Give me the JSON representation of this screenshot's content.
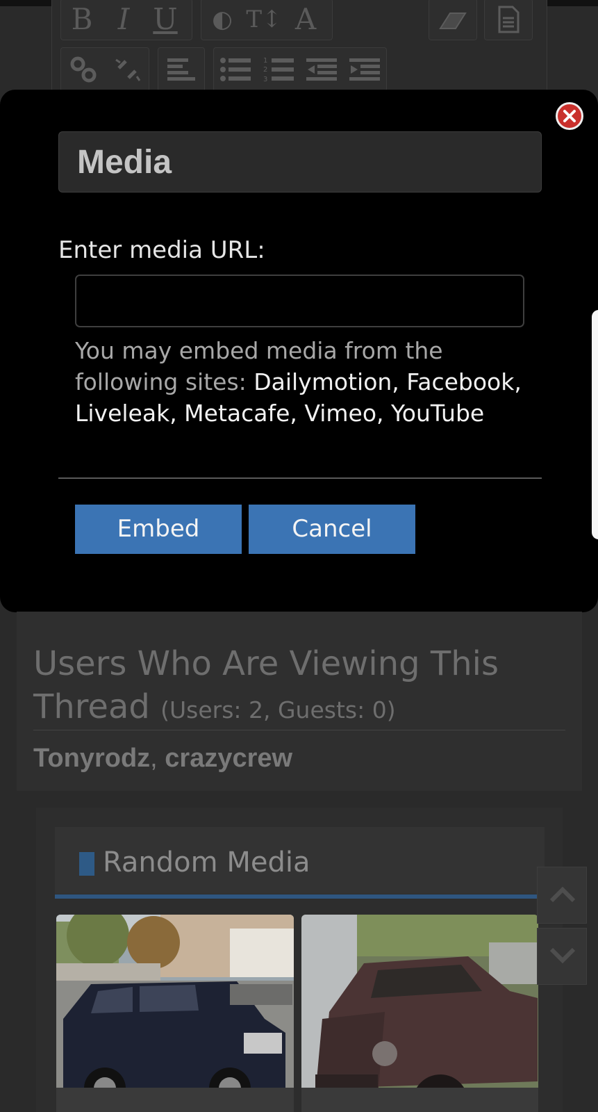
{
  "toolbar": {
    "row1": [
      "B",
      "I",
      "U",
      "◐",
      "T↕",
      "A"
    ],
    "icons_row1": [
      "bold-icon",
      "italic-icon",
      "underline-icon",
      "color-icon",
      "font-size-icon",
      "font-family-icon",
      "eraser-icon",
      "document-icon"
    ],
    "icons_row2": [
      "link-icon",
      "unlink-icon",
      "align-left-icon",
      "bullet-list-icon",
      "numbered-list-icon",
      "outdent-icon",
      "indent-icon"
    ]
  },
  "dialog": {
    "title": "Media",
    "url_label": "Enter media URL:",
    "url_value": "",
    "url_placeholder": "",
    "help_prefix": "You may embed media from the following sites: ",
    "help_sites": "Dailymotion, Facebook, Liveleak, Metacafe, Vimeo, YouTube",
    "embed_label": "Embed",
    "cancel_label": "Cancel"
  },
  "viewers": {
    "title": "Users Who Are Viewing This Thread",
    "count": "(Users: 2, Guests: 0)",
    "user1": "Tonyrodz",
    "separator": ", ",
    "user2": "crazycrew"
  },
  "random_media": {
    "title": "Random Media",
    "items": [
      {
        "name": "black-suv-photo"
      },
      {
        "name": "old-truck-photo"
      }
    ]
  },
  "colors": {
    "accent": "#3b74b4",
    "close": "#c9302c",
    "modal_bg": "#000000"
  }
}
